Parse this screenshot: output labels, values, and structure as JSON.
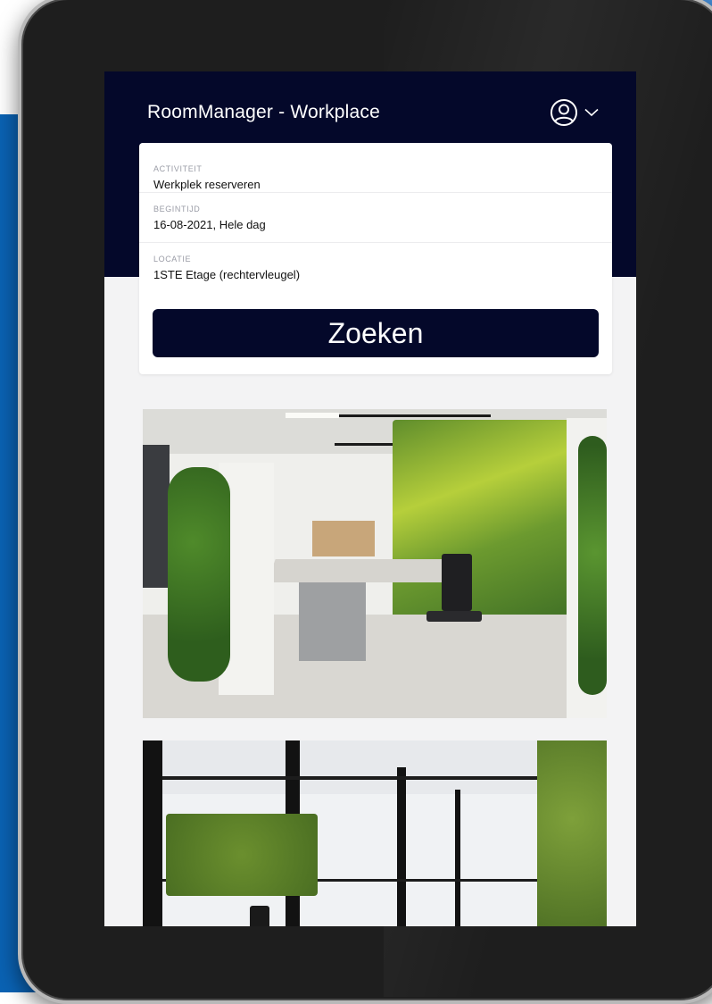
{
  "app": {
    "title": "RoomManager - Workplace"
  },
  "header": {
    "user_icon": "user-circle-icon",
    "dropdown_icon": "chevron-down-icon"
  },
  "form": {
    "activity": {
      "label": "ACTIVITEIT",
      "value": "Werkplek reserveren"
    },
    "start_time": {
      "label": "BEGINTIJD",
      "value": "16-08-2021, Hele dag"
    },
    "location": {
      "label": "LOCATIE",
      "value": "1STE Etage (rechtervleugel)"
    },
    "search_button": "Zoeken"
  },
  "colors": {
    "header_bg": "#04082a",
    "button_bg": "#04082a",
    "screen_bg": "#f3f3f4",
    "background_blue": "#0a62b3"
  }
}
